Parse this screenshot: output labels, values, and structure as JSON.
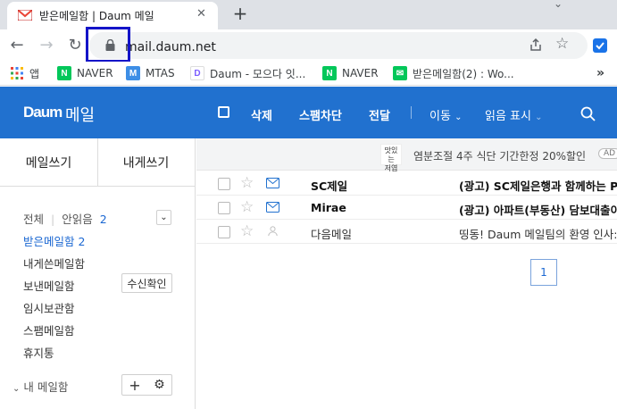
{
  "browser": {
    "tab_title": "받은메일함 | Daum 메일",
    "tab_close": "✕",
    "new_tab": "+",
    "url": "mail.daum.net"
  },
  "bookmarks": [
    {
      "label": "앱",
      "icon": "apps-grid-icon"
    },
    {
      "label": "NAVER",
      "icon": "naver-icon"
    },
    {
      "label": "MTAS",
      "icon": "mtas-icon"
    },
    {
      "label": "Daum - 모으다 잇...",
      "icon": "daum-icon"
    },
    {
      "label": "NAVER",
      "icon": "naver-icon"
    },
    {
      "label": "받은메일함(2) : Wo...",
      "icon": "mail-icon"
    }
  ],
  "bookmarks_more": "»",
  "header": {
    "logo": "Daum",
    "logo_suffix": "메일",
    "actions": {
      "delete": "삭제",
      "spam": "스팸차단",
      "forward": "전달",
      "move": "이동",
      "read_mark": "읽음 표시"
    },
    "accent": "#2171cf"
  },
  "sidebar": {
    "write": "메일쓰기",
    "write_self": "내게쓰기",
    "all_label": "전체",
    "unread_label": "안읽음",
    "unread_count": "2",
    "folders": [
      {
        "label": "받은메일함",
        "count": "2"
      },
      {
        "label": "내게쓴메일함"
      },
      {
        "label": "보낸메일함"
      },
      {
        "label": "임시보관함"
      },
      {
        "label": "스팸메일함"
      },
      {
        "label": "휴지통"
      }
    ],
    "read_receipt": "수신확인",
    "my_folders": "내 메일함",
    "add": "+"
  },
  "ad": {
    "logo_line1": "맛있는",
    "logo_line2": "저염",
    "text": "염분조절 4주 식단 기간한정 20%할인",
    "tag": "AD"
  },
  "mails": [
    {
      "sender": "SC제일",
      "subject": "(광고) SC제일은행과 함께하는 P",
      "unread": true
    },
    {
      "sender": "Mirae",
      "subject": "(광고) 아파트(부동산) 담보대출이",
      "unread": true
    },
    {
      "sender": "다음메일",
      "subject": "띵동! Daum 메일팀의 환영 인사:",
      "unread": false
    }
  ],
  "pagination": {
    "current": "1"
  }
}
